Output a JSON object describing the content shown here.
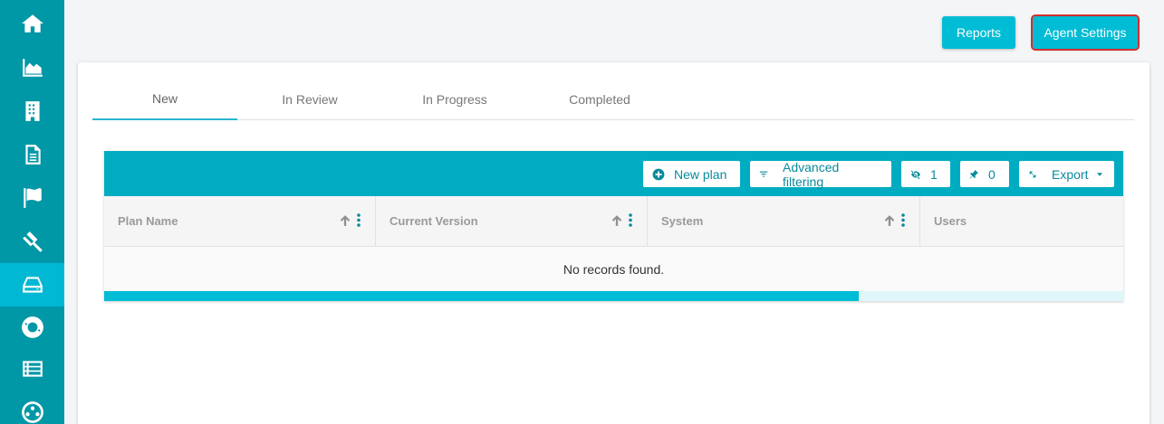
{
  "sidebar": {
    "items": [
      {
        "icon": "home-icon",
        "active": false
      },
      {
        "icon": "area-chart-icon",
        "active": false
      },
      {
        "icon": "building-icon",
        "active": false
      },
      {
        "icon": "document-icon",
        "active": false
      },
      {
        "icon": "flag-icon",
        "active": false
      },
      {
        "icon": "gavel-icon",
        "active": false
      },
      {
        "icon": "drive-icon",
        "active": true
      },
      {
        "icon": "lifebuoy-icon",
        "active": false
      },
      {
        "icon": "list-icon",
        "active": false
      },
      {
        "icon": "network-icon",
        "active": false
      }
    ]
  },
  "header": {
    "reports_label": "Reports",
    "agent_settings_label": "Agent Settings"
  },
  "tabs": [
    {
      "label": "New",
      "active": true
    },
    {
      "label": "In Review",
      "active": false
    },
    {
      "label": "In Progress",
      "active": false
    },
    {
      "label": "Completed",
      "active": false
    }
  ],
  "toolbar": {
    "new_plan_label": "New plan",
    "advanced_filtering_label": "Advanced filtering",
    "hidden_count": "1",
    "pinned_count": "0",
    "export_label": "Export"
  },
  "table": {
    "columns": [
      {
        "label": "Plan Name"
      },
      {
        "label": "Current Version"
      },
      {
        "label": "System"
      },
      {
        "label": "Users"
      }
    ],
    "empty_message": "No records found.",
    "scroll_position": 0.74
  },
  "colors": {
    "sidebar": "#0097a7",
    "sidebar_active": "#00b8d4",
    "accent": "#00acc1",
    "highlight_border": "#d32f2f"
  }
}
